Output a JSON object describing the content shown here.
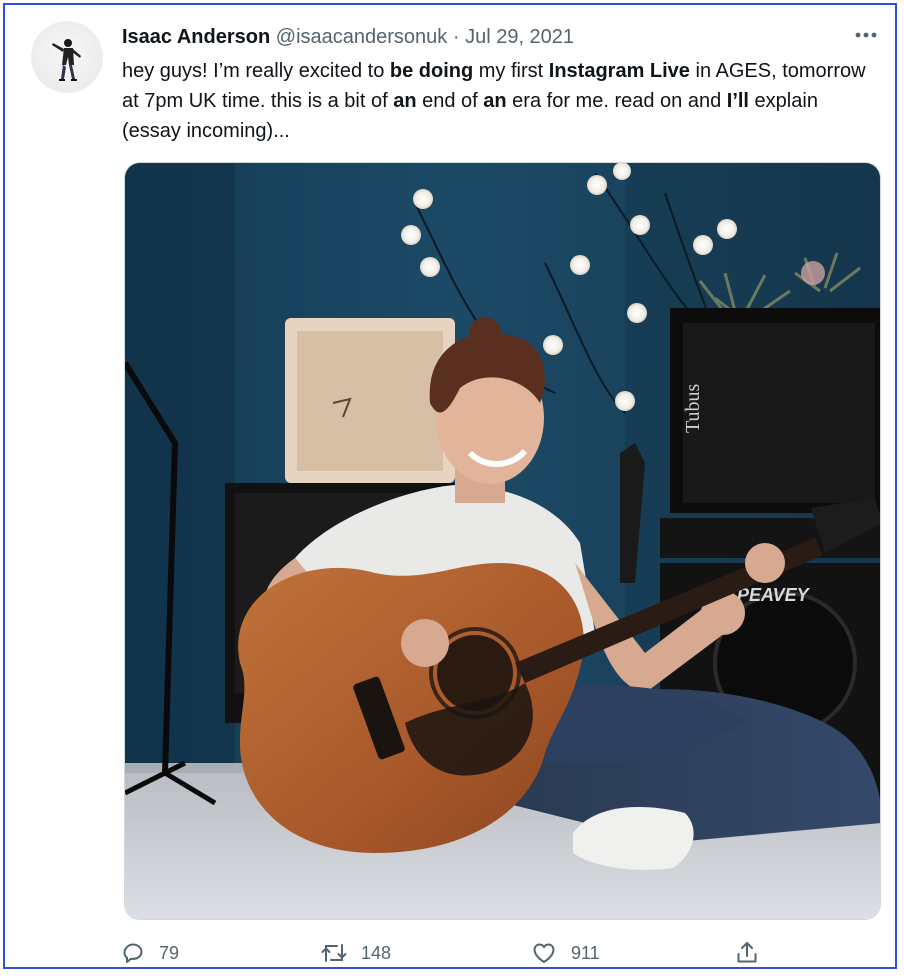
{
  "tweet": {
    "author_name": "Isaac Anderson",
    "handle": "@isaacandersonuk",
    "separator": "·",
    "date": "Jul 29, 2021",
    "text_segments": [
      "hey guys! I’m really excited to ",
      "be doing",
      " my first ",
      "Instagram Live",
      " in AGES, tomorrow at 7pm UK time. this is a bit of ",
      "an",
      " end of ",
      "an",
      " era for me. read on and ",
      "I’ll",
      " explain (essay incoming)..."
    ]
  },
  "actions": {
    "reply_count": "79",
    "retweet_count": "148",
    "like_count": "911"
  },
  "icons": {
    "more": "more-dots-icon",
    "reply": "reply-icon",
    "retweet": "retweet-icon",
    "like": "heart-icon",
    "share": "share-icon"
  },
  "colors": {
    "border": "#2f4fe0",
    "text": "#0f1419",
    "muted": "#536471"
  }
}
